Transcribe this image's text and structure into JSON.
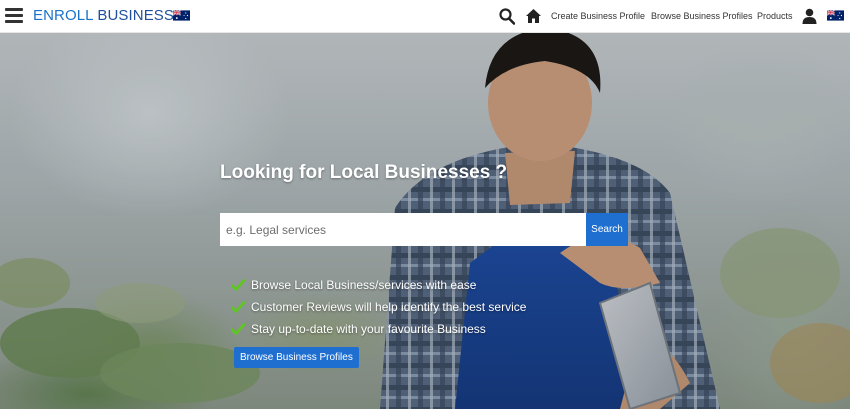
{
  "header": {
    "brand_part1": "ENROLL",
    "brand_part2": "BUSINESS",
    "menu_icon": "hamburger-menu-icon",
    "flag_icon": "australia-flag-icon",
    "search_icon": "search-icon",
    "home_icon": "home-icon",
    "user_icon": "user-icon",
    "nav_links": [
      "Create Business Profile",
      "Browse Business Profiles",
      "Products"
    ]
  },
  "hero": {
    "title": "Looking for Local Businesses ?",
    "search_placeholder": "e.g. Legal services",
    "search_value": "",
    "search_button": "Search",
    "features": [
      "Browse Local Business/services with ease",
      "Customer Reviews will help identify the best service",
      "Stay up-to-date with your favourite Business"
    ],
    "feature_icon": "check-icon",
    "browse_button": "Browse Business Profiles"
  },
  "colors": {
    "brand_blue": "#1a73c8",
    "button_blue": "#1f6fd1",
    "check_green": "#5cc81e"
  }
}
